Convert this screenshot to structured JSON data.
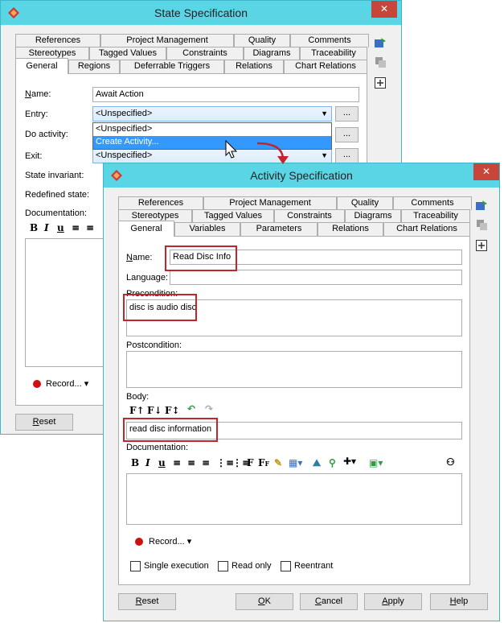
{
  "state_dialog": {
    "title": "State Specification",
    "tabs_row1": [
      "References",
      "Project Management",
      "Quality",
      "Comments"
    ],
    "tabs_row2": [
      "Stereotypes",
      "Tagged Values",
      "Constraints",
      "Diagrams",
      "Traceability"
    ],
    "tabs_row3": [
      "General",
      "Regions",
      "Deferrable Triggers",
      "Relations",
      "Chart Relations"
    ],
    "name_label": "Name:",
    "name_value": "Await Action",
    "entry_label": "Entry:",
    "entry_value": "<Unspecified>",
    "do_activity_label": "Do activity:",
    "exit_label": "Exit:",
    "exit_value": "<Unspecified>",
    "state_invariant_label": "State invariant:",
    "redefined_state_label": "Redefined state:",
    "documentation_label": "Documentation:",
    "dropdown_options": [
      "<Unspecified>",
      "Create Activity..."
    ],
    "dots": "...",
    "record_label": "Record...",
    "reset_label": "Reset"
  },
  "activity_dialog": {
    "title": "Activity Specification",
    "tabs_row1": [
      "References",
      "Project Management",
      "Quality",
      "Comments"
    ],
    "tabs_row2": [
      "Stereotypes",
      "Tagged Values",
      "Constraints",
      "Diagrams",
      "Traceability"
    ],
    "tabs_row3": [
      "General",
      "Variables",
      "Parameters",
      "Relations",
      "Chart Relations"
    ],
    "name_label": "Name:",
    "name_value": "Read Disc Info",
    "language_label": "Language:",
    "precondition_label": "Precondition:",
    "precondition_value": "disc is audio disc",
    "postcondition_label": "Postcondition:",
    "body_label": "Body:",
    "body_value": "read disc information",
    "documentation_label": "Documentation:",
    "record_label": "Record...",
    "single_execution_label": "Single execution",
    "read_only_label": "Read only",
    "reentrant_label": "Reentrant",
    "reset_label": "Reset",
    "ok_label": "OK",
    "cancel_label": "Cancel",
    "apply_label": "Apply",
    "help_label": "Help"
  },
  "colors": {
    "titlebar": "#5ad5e6",
    "close": "#c8453a",
    "highlight": "#3399ff",
    "callout": "#c0262c"
  }
}
